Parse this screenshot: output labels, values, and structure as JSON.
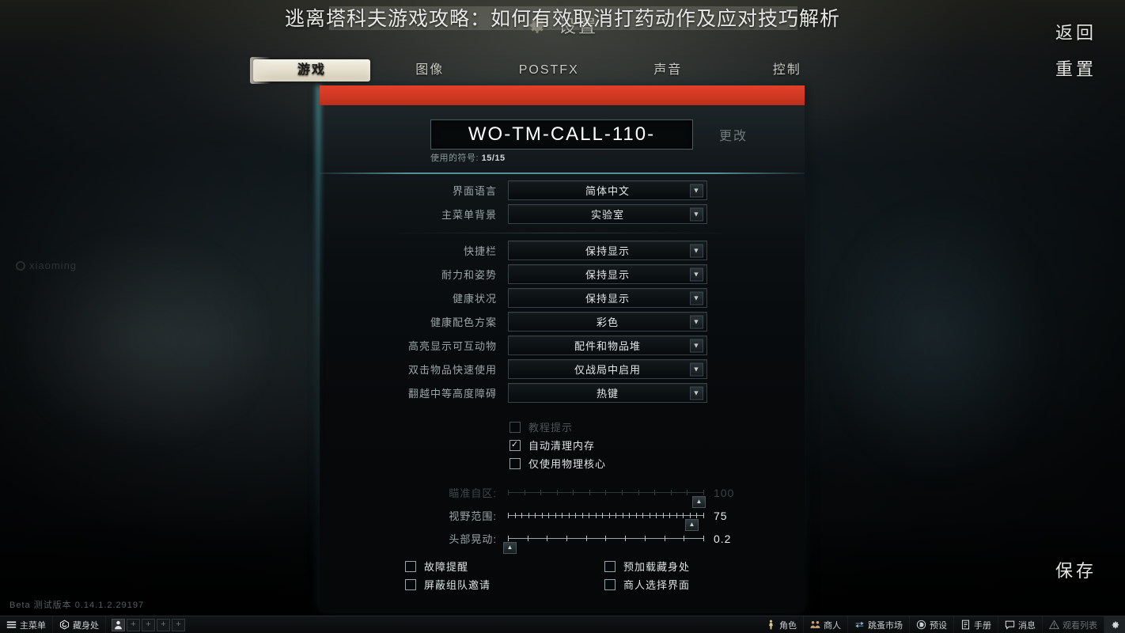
{
  "overlay": {
    "article_title": "逃离塔科夫游戏攻略：如何有效取消打药动作及应对技巧解析"
  },
  "header": {
    "settings_title": "设置",
    "gear_icon": "gear-icon"
  },
  "tabs": [
    {
      "label": "游戏",
      "active": true
    },
    {
      "label": "图像",
      "active": false
    },
    {
      "label": "POSTFX",
      "active": false
    },
    {
      "label": "声音",
      "active": false
    },
    {
      "label": "控制",
      "active": false
    }
  ],
  "nickname": {
    "value": "WO-TM-CALL-110-",
    "placeholder": "WO-TM-CALL-110-",
    "counter_label": "使用的符号:",
    "counter_value": "15/15",
    "change_label": "更改"
  },
  "settings_rows": [
    {
      "label": "界面语言",
      "value": "简体中文",
      "dim": false
    },
    {
      "label": "主菜单背景",
      "value": "实验室",
      "dim": false
    },
    {
      "label": "快捷栏",
      "value": "保持显示",
      "dim": false
    },
    {
      "label": "耐力和姿势",
      "value": "保持显示",
      "dim": false
    },
    {
      "label": "健康状况",
      "value": "保持显示",
      "dim": false
    },
    {
      "label": "健康配色方案",
      "value": "彩色",
      "dim": false
    },
    {
      "label": "高亮显示可互动物",
      "value": "配件和物品堆",
      "dim": false
    },
    {
      "label": "双击物品快速使用",
      "value": "仅战局中启用",
      "dim": false
    },
    {
      "label": "翻越中等高度障碍",
      "value": "热键",
      "dim": false
    }
  ],
  "checkboxes": [
    {
      "label": "教程提示",
      "checked": false,
      "dim": true
    },
    {
      "label": "自动清理内存",
      "checked": true,
      "dim": false
    },
    {
      "label": "仅使用物理核心",
      "checked": false,
      "dim": false
    }
  ],
  "sliders": [
    {
      "label": "瞄准自区:",
      "value": "100",
      "percent": 98,
      "ticks": 12,
      "dim": true
    },
    {
      "label": "视野范围:",
      "value": "75",
      "percent": 88,
      "ticks": 30,
      "dim": false
    },
    {
      "label": "头部晃动:",
      "value": "0.2",
      "percent": 2,
      "ticks": 10,
      "dim": false
    }
  ],
  "bottom_checks": {
    "left": [
      {
        "label": "故障提醒",
        "checked": false
      },
      {
        "label": "屏蔽组队邀请",
        "checked": false
      }
    ],
    "right": [
      {
        "label": "预加载藏身处",
        "checked": false
      },
      {
        "label": "商人选择界面",
        "checked": false
      }
    ]
  },
  "side_buttons": {
    "back": "返回",
    "reset": "重置",
    "save": "保存"
  },
  "watermark": {
    "text": "xiaoming"
  },
  "version": "Beta 测试版本 0.14.1.2.29197",
  "taskbar": {
    "left": [
      {
        "label": "主菜单",
        "icon": "menu-icon"
      },
      {
        "label": "藏身处",
        "icon": "hideout-icon"
      }
    ],
    "slots": [
      {
        "label": "",
        "filled": true,
        "icon": "avatar-icon"
      },
      {
        "label": "+",
        "filled": false,
        "icon": "plus-icon"
      },
      {
        "label": "+",
        "filled": false,
        "icon": "plus-icon"
      },
      {
        "label": "+",
        "filled": false,
        "icon": "plus-icon"
      },
      {
        "label": "+",
        "filled": false,
        "icon": "plus-icon"
      }
    ],
    "right": [
      {
        "label": "角色",
        "icon": "character-icon",
        "dim": false
      },
      {
        "label": "商人",
        "icon": "traders-icon",
        "dim": false
      },
      {
        "label": "跳蚤市场",
        "icon": "flea-market-icon",
        "dim": false
      },
      {
        "label": "预设",
        "icon": "preset-icon",
        "dim": false
      },
      {
        "label": "手册",
        "icon": "handbook-icon",
        "dim": false
      },
      {
        "label": "消息",
        "icon": "messages-icon",
        "dim": false
      },
      {
        "label": "观看列表",
        "icon": "warning-icon",
        "dim": true
      }
    ],
    "settings_icon": "gear-icon"
  },
  "colors": {
    "accent_red": "#cf3823",
    "accent_teal": "#82d7e1",
    "panel_bg": "#0a0e10",
    "tab_active_bg": "#e6e1d0"
  }
}
